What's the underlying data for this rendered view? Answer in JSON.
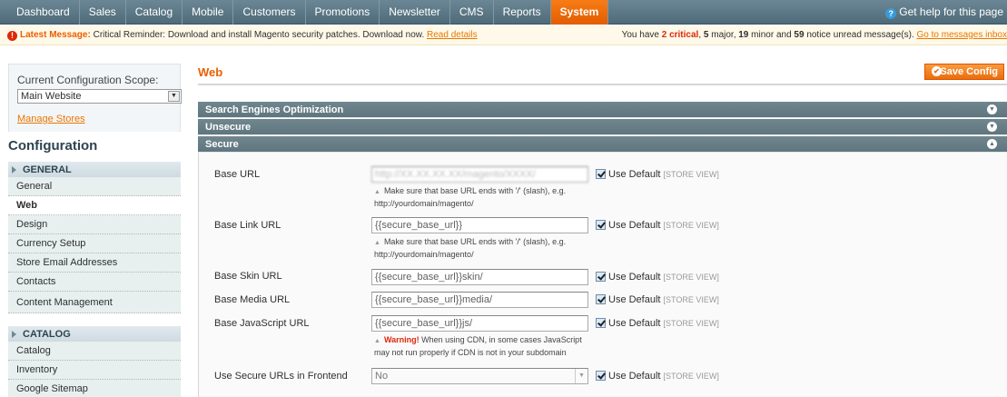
{
  "nav": {
    "items": [
      "Dashboard",
      "Sales",
      "Catalog",
      "Mobile",
      "Customers",
      "Promotions",
      "Newsletter",
      "CMS",
      "Reports",
      "System"
    ],
    "help": "Get help for this page"
  },
  "notice": {
    "label": "Latest Message:",
    "text": "Critical Reminder: Download and install Magento security patches. Download now.",
    "read_link": "Read details",
    "summary_prefix": "You have",
    "critical": "2 critical",
    "major": "5",
    "major_suffix": "major,",
    "minor": "19",
    "minor_suffix": "minor and",
    "notice_count": "59",
    "notice_suffix": "notice unread message(s).",
    "inbox_link": "Go to messages inbox"
  },
  "sidebar": {
    "scope_label": "Current Configuration Scope:",
    "scope_value": "Main Website",
    "manage_stores": "Manage Stores",
    "config_title": "Configuration",
    "groups": [
      {
        "head": "GENERAL",
        "items": [
          "General",
          "Web",
          "Design",
          "Currency Setup",
          "Store Email Addresses",
          "Contacts",
          "Content Management"
        ]
      },
      {
        "head": "CATALOG",
        "items": [
          "Catalog",
          "Inventory",
          "Google Sitemap"
        ]
      }
    ]
  },
  "main": {
    "title": "Web",
    "save_label": "Save Config",
    "sections": [
      "Search Engines Optimization",
      "Unsecure",
      "Secure"
    ],
    "use_default": "Use Default",
    "scope_tag": "[STORE VIEW]",
    "fields": {
      "base_url": {
        "label": "Base URL",
        "value": "http://XX.XX.XX.XX/magento/XXXX/",
        "note1": "Make sure that base URL ends with '/' (slash), e.g.",
        "note2": "http://yourdomain/magento/"
      },
      "base_link_url": {
        "label": "Base Link URL",
        "value": "{{secure_base_url}}",
        "note1": "Make sure that base URL ends with '/' (slash), e.g.",
        "note2": "http://yourdomain/magento/"
      },
      "base_skin_url": {
        "label": "Base Skin URL",
        "value": "{{secure_base_url}}skin/"
      },
      "base_media_url": {
        "label": "Base Media URL",
        "value": "{{secure_base_url}}media/"
      },
      "base_js_url": {
        "label": "Base JavaScript URL",
        "value": "{{secure_base_url}}js/",
        "warn": "Warning!",
        "note1": "When using CDN, in some cases JavaScript",
        "note2": "may not run properly if CDN is not in your subdomain"
      },
      "use_secure_frontend": {
        "label": "Use Secure URLs in Frontend",
        "value": "No"
      }
    }
  }
}
